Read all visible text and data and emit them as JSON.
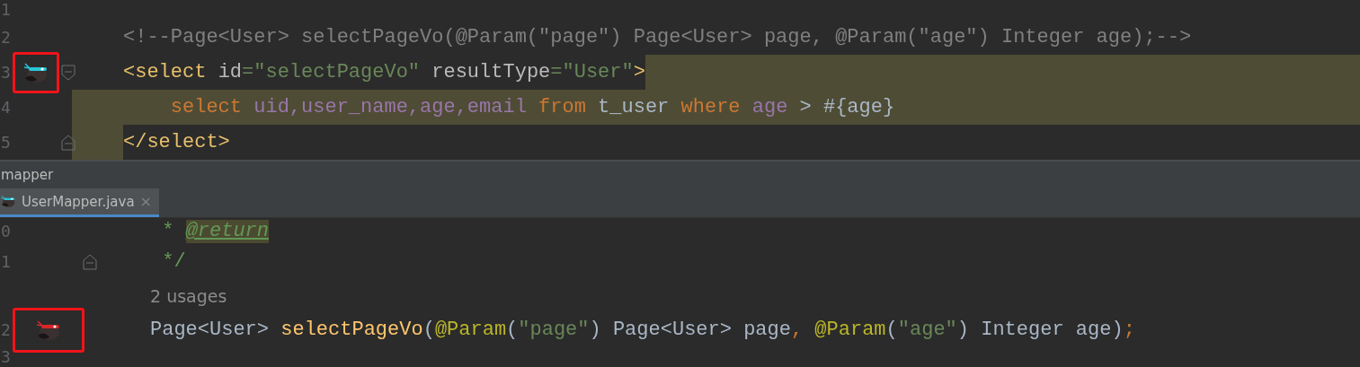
{
  "top_editor": {
    "lines": [
      {
        "number": "1"
      },
      {
        "number": "2",
        "tokens": [
          {
            "kind": "comment",
            "text": "<!--Page<User> selectPageVo(@Param(\"page\") Page<User> page, @Param(\"age\") Integer age);-->"
          }
        ]
      },
      {
        "number": "3",
        "fold_open": true,
        "selected": true,
        "gutter_marker": {
          "color": "#27c6d8",
          "framed": true
        },
        "tokens": [
          {
            "kind": "tag",
            "text": "<select "
          },
          {
            "kind": "attr",
            "text": "id"
          },
          {
            "kind": "string",
            "text": "=\"selectPageVo\" "
          },
          {
            "kind": "attr",
            "text": "resultType"
          },
          {
            "kind": "string",
            "text": "=\"User\""
          },
          {
            "kind": "tag",
            "text": ">"
          }
        ]
      },
      {
        "number": "4",
        "selected": true,
        "tokens": [
          {
            "kind": "keyword",
            "text": "    select "
          },
          {
            "kind": "column",
            "text": "uid,user_name,age,email "
          },
          {
            "kind": "keyword",
            "text": "from "
          },
          {
            "kind": "plain",
            "text": "t_user "
          },
          {
            "kind": "keyword",
            "text": "where "
          },
          {
            "kind": "column",
            "text": "age "
          },
          {
            "kind": "plain",
            "text": "> #{age}"
          }
        ]
      },
      {
        "number": "5",
        "fold_close": true,
        "selected": true,
        "tokens": [
          {
            "kind": "tag",
            "text": "</select>"
          }
        ]
      }
    ]
  },
  "panel_title": "mapper",
  "tabs": [
    {
      "label": "UserMapper.java",
      "selected": true,
      "close": "×"
    }
  ],
  "bottom_editor": {
    "lines": [
      {
        "number": "0",
        "tokens": [
          {
            "kind": "doc",
            "text": " * "
          },
          {
            "kind": "doctag",
            "text": "@return"
          }
        ]
      },
      {
        "number": "1",
        "fold_close": true,
        "tokens": [
          {
            "kind": "doc",
            "text": " */"
          }
        ]
      },
      {
        "inlay": "2 usages"
      },
      {
        "number": "2",
        "gutter_marker": {
          "color": "#d8262a",
          "framed": true
        },
        "tokens": [
          {
            "kind": "plain",
            "text": "Page<User> "
          },
          {
            "kind": "func",
            "text": "selectPageVo"
          },
          {
            "kind": "plain",
            "text": "("
          },
          {
            "kind": "annotation",
            "text": "@Param"
          },
          {
            "kind": "plain",
            "text": "("
          },
          {
            "kind": "string",
            "text": "\"page\""
          },
          {
            "kind": "plain",
            "text": ") Page<User> page"
          },
          {
            "kind": "keyword",
            "text": ", "
          },
          {
            "kind": "annotation",
            "text": "@Param"
          },
          {
            "kind": "plain",
            "text": "("
          },
          {
            "kind": "string",
            "text": "\"age\""
          },
          {
            "kind": "plain",
            "text": ") Integer age)"
          },
          {
            "kind": "keyword",
            "text": ";"
          }
        ]
      },
      {
        "number": "3"
      }
    ]
  }
}
